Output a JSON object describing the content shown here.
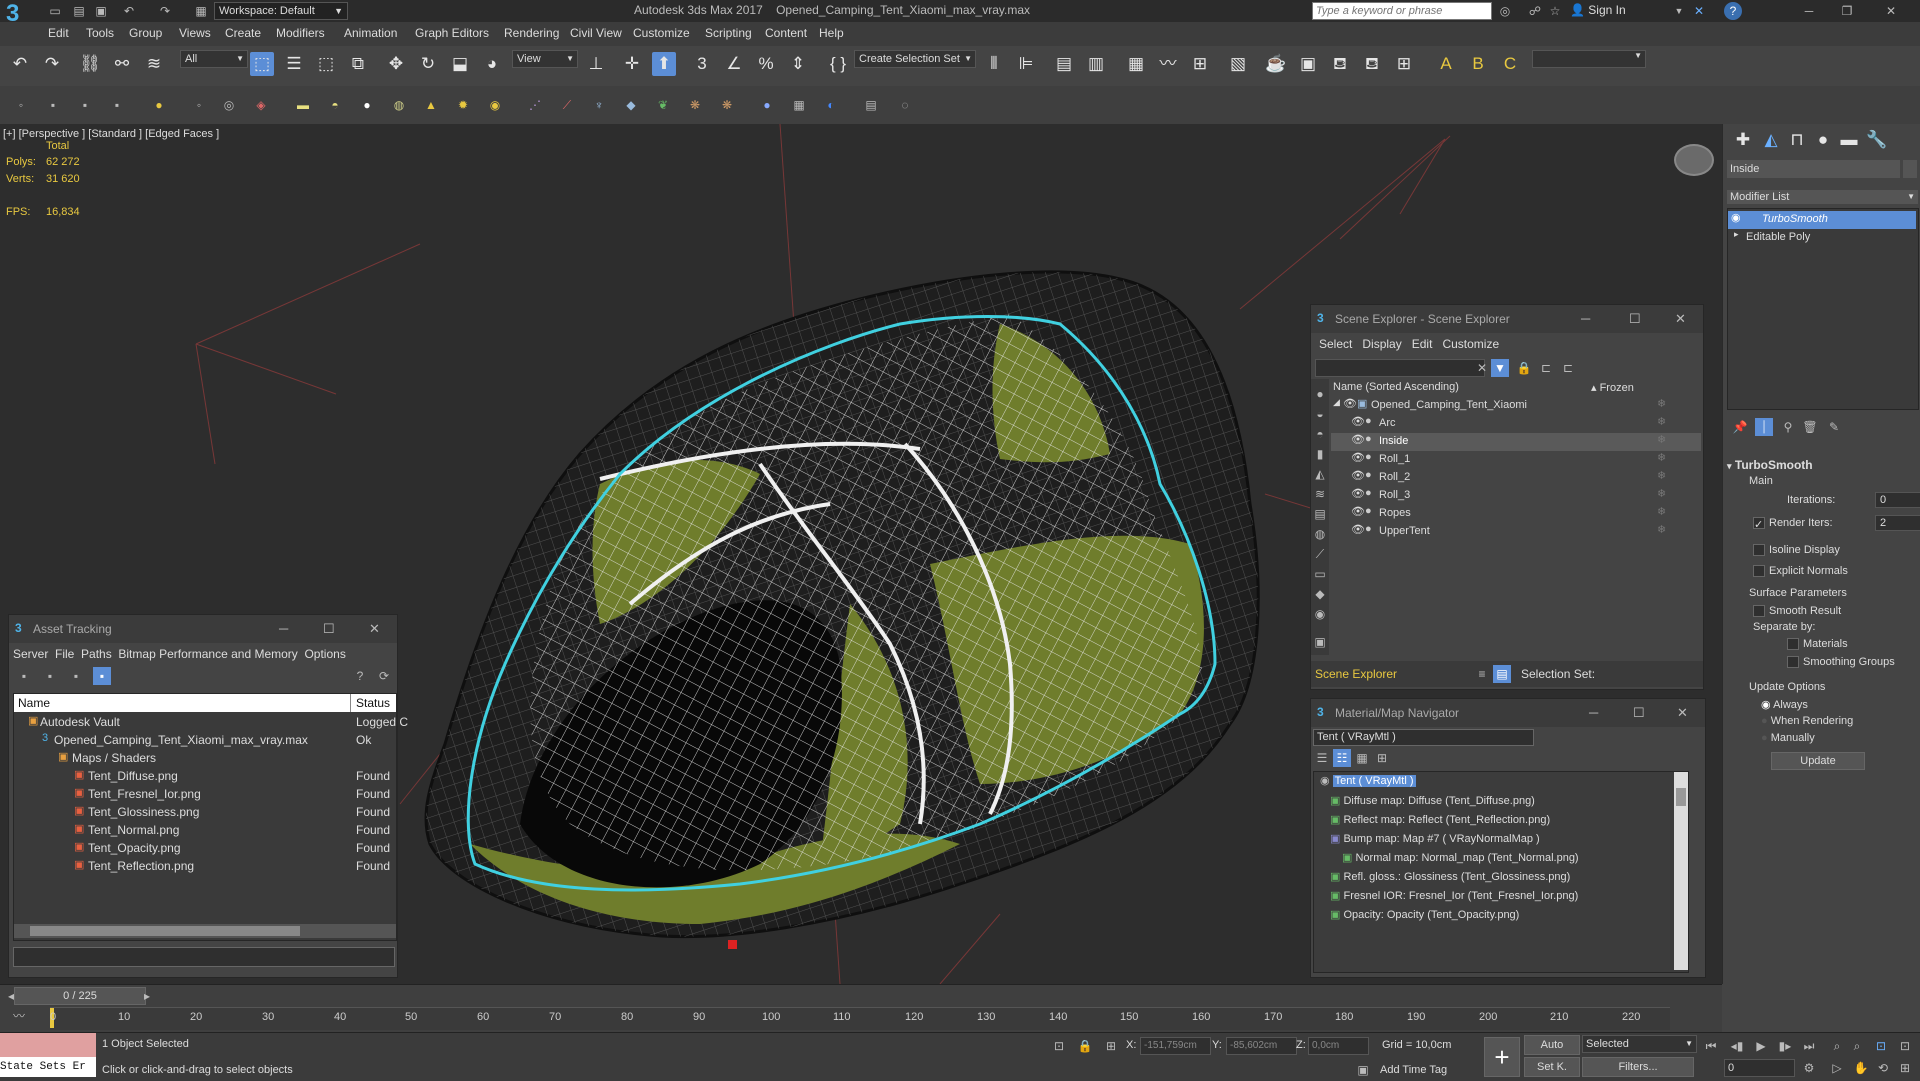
{
  "titlebar": {
    "workspace": "Workspace: Default",
    "app_title": "Autodesk 3ds Max 2017",
    "file_name": "Opened_Camping_Tent_Xiaomi_max_vray.max",
    "search_placeholder": "Type a keyword or phrase",
    "sign_in": "Sign In"
  },
  "menu": [
    "Edit",
    "Tools",
    "Group",
    "Views",
    "Create",
    "Modifiers",
    "Animation",
    "Graph Editors",
    "Rendering",
    "Civil View",
    "Customize",
    "Scripting",
    "Content",
    "Help"
  ],
  "toolbar": {
    "filter": "All",
    "ref_coord": "View",
    "selection_set": "Create Selection Set"
  },
  "viewport": {
    "label": "[+] [Perspective ] [Standard ] [Edged Faces ]",
    "stats_total": "Total",
    "polys_label": "Polys:",
    "polys_value": "62 272",
    "verts_label": "Verts:",
    "verts_value": "31 620",
    "fps_label": "FPS:",
    "fps_value": "16,834"
  },
  "asset_tracking": {
    "title": "Asset Tracking",
    "menu": [
      "Server",
      "File",
      "Paths",
      "Bitmap Performance and Memory",
      "Options"
    ],
    "col_name": "Name",
    "col_status": "Status",
    "rows": [
      {
        "name": "Autodesk Vault",
        "status": "Logged C"
      },
      {
        "name": "Opened_Camping_Tent_Xiaomi_max_vray.max",
        "status": "Ok"
      },
      {
        "name": "Maps / Shaders",
        "status": ""
      },
      {
        "name": "Tent_Diffuse.png",
        "status": "Found"
      },
      {
        "name": "Tent_Fresnel_Ior.png",
        "status": "Found"
      },
      {
        "name": "Tent_Glossiness.png",
        "status": "Found"
      },
      {
        "name": "Tent_Normal.png",
        "status": "Found"
      },
      {
        "name": "Tent_Opacity.png",
        "status": "Found"
      },
      {
        "name": "Tent_Reflection.png",
        "status": "Found"
      }
    ]
  },
  "scene_explorer": {
    "title": "Scene Explorer - Scene Explorer",
    "menu": [
      "Select",
      "Display",
      "Edit",
      "Customize"
    ],
    "col_name": "Name (Sorted Ascending)",
    "col_frozen": "▴ Frozen",
    "root": "Opened_Camping_Tent_Xiaomi",
    "items": [
      "Arc",
      "Inside",
      "Roll_1",
      "Roll_2",
      "Roll_3",
      "Ropes",
      "UpperTent"
    ],
    "footer_name": "Scene Explorer",
    "selection_set": "Selection Set:"
  },
  "material_navigator": {
    "title": "Material/Map Navigator",
    "current": "Tent  ( VRayMtl )",
    "root": "Tent  ( VRayMtl )",
    "items": [
      "Diffuse map: Diffuse (Tent_Diffuse.png)",
      "Reflect map: Reflect (Tent_Reflection.png)",
      "Bump map: Map #7  ( VRayNormalMap )",
      "Normal map: Normal_map (Tent_Normal.png)",
      "Refl. gloss.: Glossiness (Tent_Glossiness.png)",
      "Fresnel IOR: Fresnel_Ior (Tent_Fresnel_Ior.png)",
      "Opacity: Opacity (Tent_Opacity.png)"
    ]
  },
  "command_panel": {
    "object_name": "Inside",
    "modifier_list": "Modifier List",
    "stack": [
      "TurboSmooth",
      "Editable Poly"
    ],
    "rollout": "TurboSmooth",
    "main": "Main",
    "iterations_label": "Iterations:",
    "iterations_value": "0",
    "render_iters_label": "Render Iters:",
    "render_iters_value": "2",
    "isoline": "Isoline Display",
    "explicit_normals": "Explicit Normals",
    "surface_params": "Surface Parameters",
    "smooth_result": "Smooth Result",
    "separate_by": "Separate by:",
    "materials": "Materials",
    "smoothing_groups": "Smoothing Groups",
    "update_options": "Update Options",
    "always": "Always",
    "when_rendering": "When Rendering",
    "manually": "Manually",
    "update_btn": "Update"
  },
  "timeline": {
    "frame": "0 / 225",
    "ticks": [
      "0",
      "10",
      "20",
      "30",
      "40",
      "50",
      "60",
      "70",
      "80",
      "90",
      "100",
      "110",
      "120",
      "130",
      "140",
      "150",
      "160",
      "170",
      "180",
      "190",
      "200",
      "210",
      "220"
    ]
  },
  "status": {
    "script_label": "State Sets Er",
    "selected": "1 Object Selected",
    "prompt": "Click or click-and-drag to select objects",
    "x_label": "X:",
    "x_value": "-151,759cm",
    "y_label": "Y:",
    "y_value": "-85,602cm",
    "z_label": "Z:",
    "z_value": "0,0cm",
    "grid": "Grid = 10,0cm",
    "add_time_tag": "Add Time Tag",
    "auto": "Auto",
    "selected_dd": "Selected",
    "setk": "Set K.",
    "filters": "Filters...",
    "frame_field": "0"
  },
  "colors": {
    "accent": "#5c8ed6",
    "selection": "#40d0e0",
    "stats": "#e8c840",
    "tent": "#7a8a2a"
  }
}
